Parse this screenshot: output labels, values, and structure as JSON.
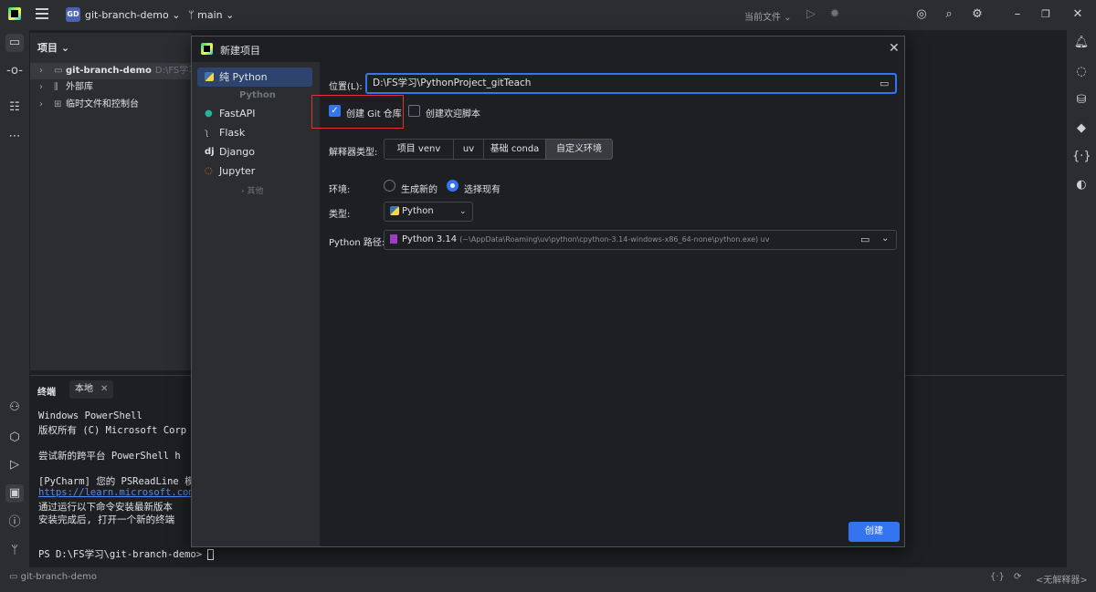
{
  "titlebar": {
    "project_badge": "GD",
    "project_name": "git-branch-demo",
    "branch": "main",
    "run_config": "当前文件",
    "icons": [
      "pycharm-logo-icon",
      "hamburger-menu-icon",
      "chevron-down-icon",
      "branch-icon",
      "run-icon",
      "debug-icon",
      "ai-assistant-icon",
      "search-icon",
      "settings-icon",
      "minimize-icon",
      "restore-icon",
      "close-icon"
    ]
  },
  "left_strip": {
    "icons": [
      "project-folder-icon",
      "commit-icon",
      "structure-icon",
      "more-icon",
      "python-packages-icon",
      "services-icon",
      "run-icon",
      "terminal-icon",
      "problems-icon",
      "git-icon"
    ]
  },
  "right_strip": {
    "icons": [
      "notifications-icon",
      "ai-chat-icon",
      "database-icon",
      "plugins-icon",
      "code-with-me-icon",
      "copilot-icon"
    ]
  },
  "project_panel": {
    "title": "项目",
    "tree": [
      {
        "label": "git-branch-demo",
        "path": "D:\\FS学习\\gi",
        "selected": true
      },
      {
        "label": "外部库",
        "path": ""
      },
      {
        "label": "临时文件和控制台",
        "path": ""
      }
    ]
  },
  "terminal": {
    "title": "终端",
    "tab": "本地",
    "lines": [
      "Windows PowerShell",
      "版权所有 (C) Microsoft Corp",
      "",
      "尝试新的跨平台 PowerShell h",
      "",
      "[PyCharm] 您的 PSReadLine 模",
      "https://learn.microsoft.com",
      "通过运行以下命令安装最新版本",
      "安装完成后, 打开一个新的终端"
    ],
    "prompt": "PS D:\\FS学习\\git-branch-demo> "
  },
  "statusbar": {
    "project": "git-branch-demo",
    "interpreter": "<无解释器>"
  },
  "dialog": {
    "title": "新建项目",
    "sidebar": {
      "selected": "纯 Python",
      "group_python": "Python",
      "items": [
        "FastAPI",
        "Flask",
        "Django",
        "Jupyter"
      ],
      "more": "其他"
    },
    "location_label": "位置(L):",
    "location_value": "D:\\FS学习\\PythonProject_gitTeach",
    "create_git_label": "创建 Git 仓库",
    "create_git_checked": true,
    "create_welcome_label": "创建欢迎脚本",
    "create_welcome_checked": false,
    "interpreter_type_label": "解释器类型:",
    "interpreter_types": [
      "项目 venv",
      "uv",
      "基础 conda",
      "自定义环境"
    ],
    "interpreter_type_selected": "自定义环境",
    "env_label": "环境:",
    "env_generate_label": "生成新的",
    "env_select_label": "选择现有",
    "env_selected": "选择现有",
    "type_label": "类型:",
    "type_value": "Python",
    "python_path_label": "Python 路径:",
    "python_path_version": "Python 3.14",
    "python_path_detail": "(~\\AppData\\Roaming\\uv\\python\\cpython-3.14-windows-x86_64-none\\python.exe) uv",
    "create_button": "创建",
    "colors": {
      "accent": "#3574f0",
      "highlight_box": "#e0313a"
    }
  }
}
